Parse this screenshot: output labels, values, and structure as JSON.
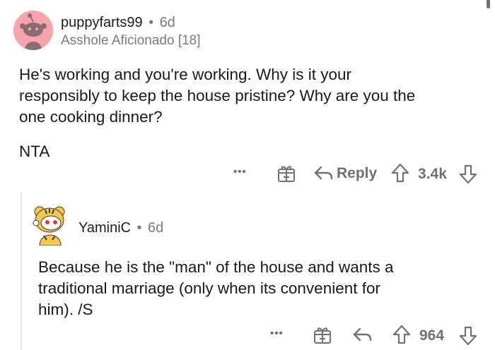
{
  "comment": {
    "username": "puppyfarts99",
    "separator": "•",
    "time": "6d",
    "flair": "Asshole Aficionado [18]",
    "body_lines": [
      "He's working and you're working. Why is it your",
      "responsibly to keep the house pristine? Why are you the",
      "one cooking dinner?"
    ],
    "verdict": "NTA",
    "actions": {
      "more": "•••",
      "reply_label": "Reply",
      "score": "3.4k"
    }
  },
  "reply": {
    "username": "YaminiC",
    "separator": "•",
    "time": "6d",
    "body_lines": [
      "Because he is the \"man\" of the house and wants a",
      "traditional marriage (only when its convenient for",
      "him). /S"
    ],
    "actions": {
      "more": "•••",
      "score": "964"
    }
  },
  "colors": {
    "avatar_pink": "#f7a4ad",
    "meta_gray": "#787c7e",
    "icon_gray": "#6f7275",
    "thread_line": "#e4e6e8"
  }
}
